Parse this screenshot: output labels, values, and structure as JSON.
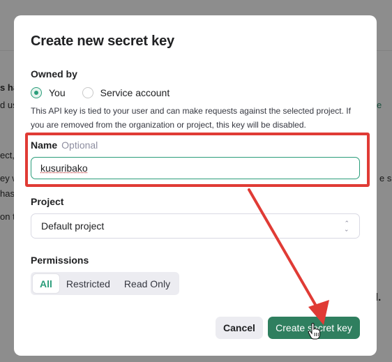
{
  "background": {
    "fragments": [
      "s ha",
      "d us",
      "e",
      "ect,",
      "ey w",
      "e se",
      "has",
      "on t",
      "l."
    ]
  },
  "modal": {
    "title": "Create new secret key",
    "owned_by": {
      "label": "Owned by",
      "options": [
        {
          "label": "You",
          "selected": true
        },
        {
          "label": "Service account",
          "selected": false
        }
      ],
      "help_text": "This API key is tied to your user and can make requests against the selected project. If you are removed from the organization or project, this key will be disabled."
    },
    "name": {
      "label": "Name",
      "optional_text": "Optional",
      "value": "kusuribako"
    },
    "project": {
      "label": "Project",
      "selected": "Default project",
      "icon": "chevron-updown-icon"
    },
    "permissions": {
      "label": "Permissions",
      "options": [
        "All",
        "Restricted",
        "Read Only"
      ],
      "selected": "All"
    },
    "buttons": {
      "cancel": "Cancel",
      "create": "Create secret key"
    }
  },
  "colors": {
    "accent": "#2a9d7a",
    "create_button": "#2f7f5f",
    "annotation_red": "#e03b35"
  }
}
